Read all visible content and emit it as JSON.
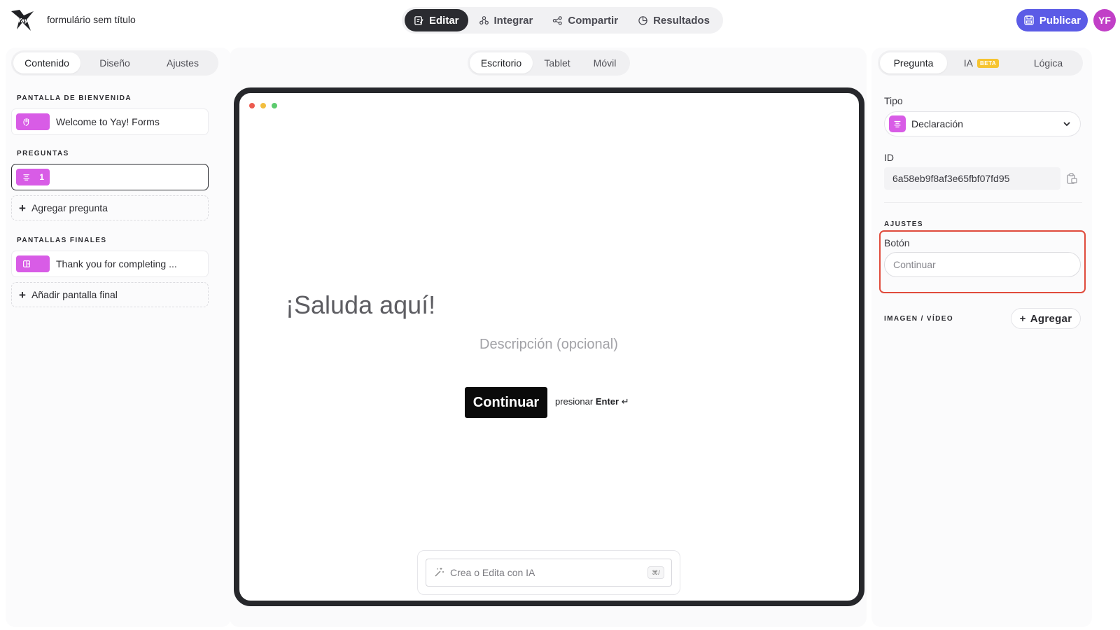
{
  "header": {
    "form_title": "formulário sem título",
    "tabs": [
      {
        "label": "Editar",
        "icon": "edit-icon",
        "active": true
      },
      {
        "label": "Integrar",
        "icon": "integrate-icon",
        "active": false
      },
      {
        "label": "Compartir",
        "icon": "share-icon",
        "active": false
      },
      {
        "label": "Resultados",
        "icon": "results-icon",
        "active": false
      }
    ],
    "publish_label": "Publicar",
    "avatar_initials": "YF",
    "accent_color": "#5b5be6",
    "avatar_color": "#c13fc7"
  },
  "left": {
    "tabs": [
      {
        "label": "Contenido",
        "active": true
      },
      {
        "label": "Diseño",
        "active": false
      },
      {
        "label": "Ajustes",
        "active": false
      }
    ],
    "welcome_label": "PANTALLA DE BIENVENIDA",
    "welcome_item": "Welcome to Yay! Forms",
    "questions_label": "PREGUNTAS",
    "question_number": "1",
    "add_question": "Agregar pregunta",
    "endings_label": "PANTALLAS FINALES",
    "ending_item": "Thank you for completing ...",
    "add_ending": "Añadir pantalla final",
    "pill_color": "#d85ce6"
  },
  "center": {
    "device_tabs": [
      {
        "label": "Escritorio",
        "active": true
      },
      {
        "label": "Tablet",
        "active": false
      },
      {
        "label": "Móvil",
        "active": false
      }
    ],
    "preview": {
      "title": "¡Saluda aquí!",
      "description": "Descripción (opcional)",
      "button_label": "Continuar",
      "press_prefix": "presionar",
      "press_key": "Enter",
      "enter_glyph": "↵"
    },
    "ai_placeholder": "Crea o Edita con IA",
    "ai_shortcut": "⌘/"
  },
  "right": {
    "tabs": [
      {
        "label": "Pregunta",
        "active": true
      },
      {
        "label": "IA",
        "badge": "BETA",
        "active": false
      },
      {
        "label": "Lógica",
        "active": false
      }
    ],
    "type_label": "Tipo",
    "type_value": "Declaración",
    "id_label": "ID",
    "id_value": "6a58eb9f8af3e65fbf07fd95",
    "settings_label": "AJUSTES",
    "button_label": "Botón",
    "button_placeholder": "Continuar",
    "media_label": "IMAGEN / VÍDEO",
    "add_media": "Agregar",
    "highlight_color": "#e04b3c"
  }
}
